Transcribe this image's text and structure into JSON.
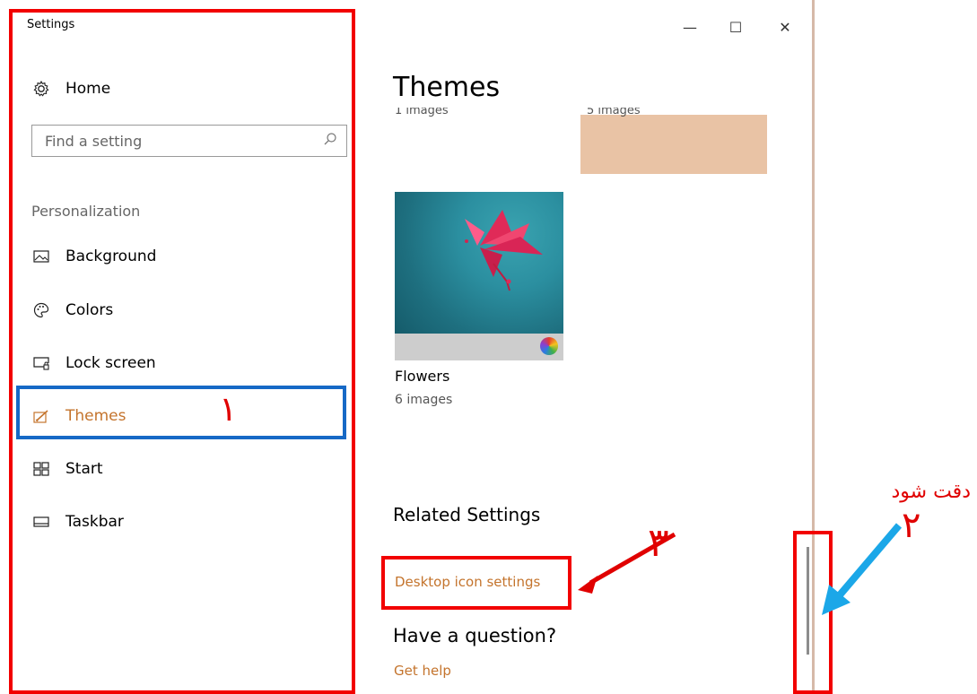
{
  "window": {
    "title": "Settings",
    "minimize_label": "—",
    "maximize_label": "☐",
    "close_label": "✕"
  },
  "sidebar": {
    "home_label": "Home",
    "search_placeholder": "Find a setting",
    "section_label": "Personalization",
    "items": [
      {
        "label": "Background",
        "icon": "picture-icon"
      },
      {
        "label": "Colors",
        "icon": "palette-icon"
      },
      {
        "label": "Lock screen",
        "icon": "lock-screen-icon"
      },
      {
        "label": "Themes",
        "icon": "brush-icon",
        "active": true
      },
      {
        "label": "Start",
        "icon": "start-grid-icon"
      },
      {
        "label": "Taskbar",
        "icon": "taskbar-icon"
      }
    ]
  },
  "main": {
    "page_title": "Themes",
    "partial_tiles": [
      {
        "caption": "1 images"
      },
      {
        "caption": "5 images"
      }
    ],
    "theme_tile": {
      "name": "Flowers",
      "count": "6 images"
    },
    "related_heading": "Related Settings",
    "related_link": "Desktop icon settings",
    "question_heading": "Have a question?",
    "help_link": "Get help"
  },
  "annotations": {
    "num_1": "١",
    "num_2": "۲",
    "num_3": "۳",
    "note": "دقت شود"
  },
  "colors": {
    "accent": "#c4742d",
    "annotation_red": "#f20000",
    "annotation_blue": "#1669c6",
    "arrow_blue": "#1ba7e8"
  }
}
